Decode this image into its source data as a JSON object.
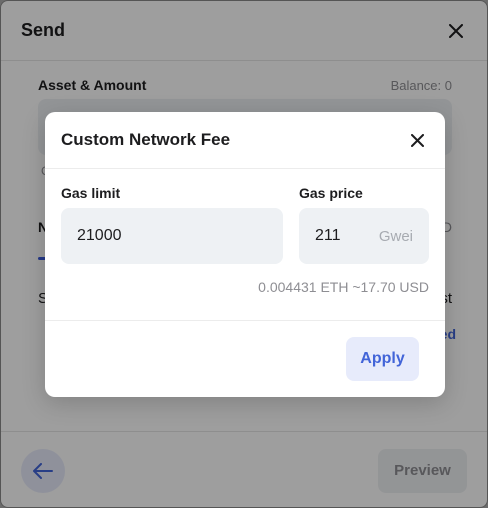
{
  "send": {
    "title": "Send",
    "asset_label": "Asset & Amount",
    "balance": "Balance: 0",
    "preview_label": "Preview",
    "fragments": {
      "c": "C",
      "n": "N",
      "d": "D",
      "s": "S",
      "st": "st",
      "ed": "ed"
    }
  },
  "modal": {
    "title": "Custom Network Fee",
    "gas_limit_label": "Gas limit",
    "gas_limit_value": "21000",
    "gas_price_label": "Gas price",
    "gas_price_value": "211",
    "gas_price_unit": "Gwei",
    "fee_estimate": "0.004431 ETH ~17.70 USD",
    "apply_label": "Apply"
  },
  "colors": {
    "accent": "#4264d8",
    "accent_bg": "#e7ebfb",
    "input_bg": "#eef1f4"
  },
  "icons": {
    "close": "close-icon",
    "back": "arrow-left-icon"
  }
}
